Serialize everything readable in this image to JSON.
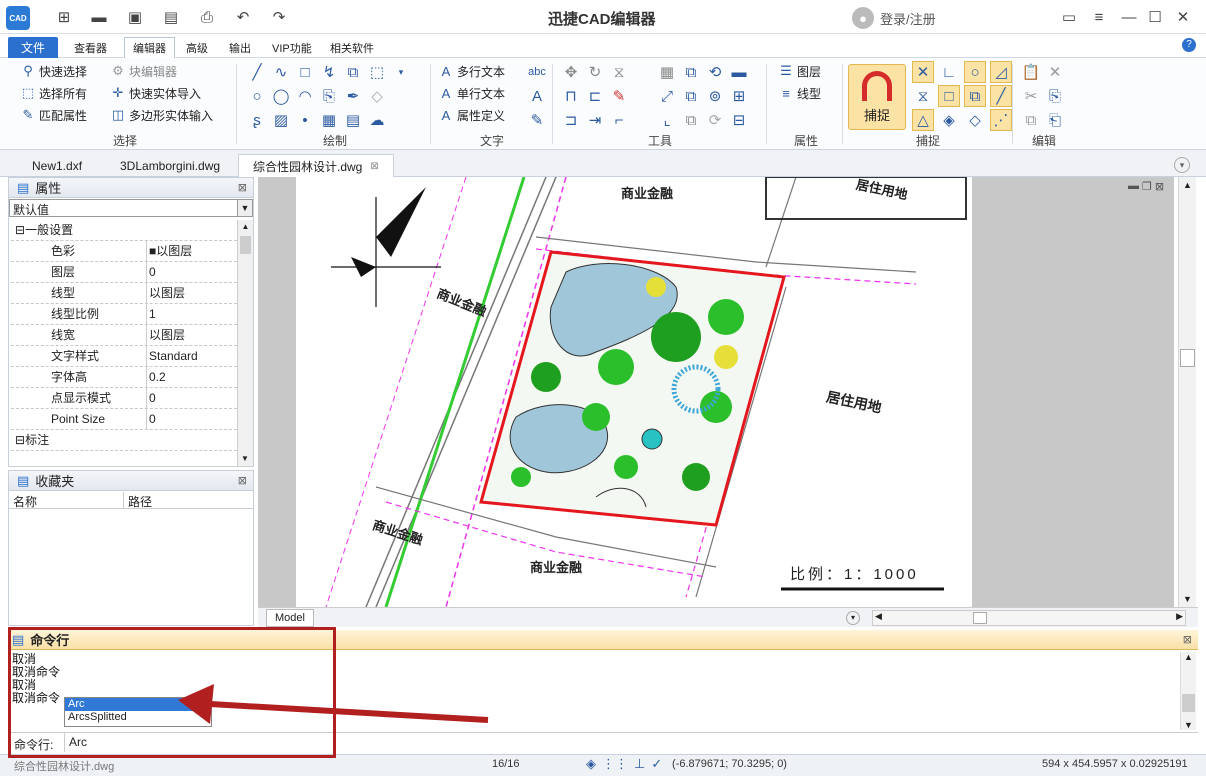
{
  "app": {
    "title": "迅捷CAD编辑器",
    "logo_text": "CAD",
    "login_text": "登录/注册"
  },
  "quick_toolbar": [
    "new-icon",
    "open-icon",
    "save-icon",
    "pdf-icon",
    "print-icon",
    "undo-icon",
    "redo-icon"
  ],
  "menu_tabs": [
    {
      "label": "文件"
    },
    {
      "label": "查看器"
    },
    {
      "label": "编辑器"
    },
    {
      "label": "高级"
    },
    {
      "label": "输出"
    },
    {
      "label": "VIP功能"
    },
    {
      "label": "相关软件"
    }
  ],
  "ribbon": {
    "select": {
      "label": "选择",
      "items": [
        "快速选择",
        "块编辑器",
        "选择所有",
        "快速实体导入",
        "匹配属性",
        "多边形实体输入"
      ]
    },
    "draw": {
      "label": "绘制"
    },
    "text": {
      "label": "文字",
      "items": [
        "多行文本",
        "单行文本",
        "属性定义"
      ]
    },
    "tools": {
      "label": "工具"
    },
    "properties": {
      "label": "属性",
      "items": [
        "图层",
        "线型"
      ]
    },
    "snap": {
      "label": "捕捉",
      "big_button": "捕捉"
    },
    "edit": {
      "label": "编辑"
    }
  },
  "doc_tabs": [
    {
      "label": "New1.dxf"
    },
    {
      "label": "3DLamborgini.dwg"
    },
    {
      "label": "综合性园林设计.dwg"
    }
  ],
  "properties_panel": {
    "title": "属性",
    "dropdown_value": "默认值",
    "category_general": "一般设置",
    "rows": [
      {
        "key": "色彩",
        "value": "■以图层"
      },
      {
        "key": "图层",
        "value": "0"
      },
      {
        "key": "线型",
        "value": "以图层"
      },
      {
        "key": "线型比例",
        "value": "1"
      },
      {
        "key": "线宽",
        "value": "以图层"
      },
      {
        "key": "文字样式",
        "value": "Standard"
      },
      {
        "key": "字体高",
        "value": "0.2"
      },
      {
        "key": "点显示模式",
        "value": "0"
      },
      {
        "key": "Point Size",
        "value": "0"
      }
    ],
    "category_annotation": "标注"
  },
  "favorites_panel": {
    "title": "收藏夹",
    "columns": [
      "名称",
      "路径"
    ]
  },
  "drawing": {
    "labels": {
      "commerce_top": "商业金融",
      "commerce_left": "商业金融",
      "commerce_bottom_left": "商业金融",
      "commerce_bottom": "商业金融",
      "residential_right": "居住用地",
      "residential_top": "居住用地",
      "scale": "比例：1：1000"
    },
    "model_tab": "Model"
  },
  "command_panel": {
    "title": "命令行",
    "history": [
      "取消",
      "取消命令",
      "取消",
      "取消命令"
    ],
    "autocomplete": [
      "Arc",
      "ArcsSplitted"
    ],
    "prompt_label": "命令行:",
    "input_value": "Arc"
  },
  "status_bar": {
    "file": "综合性园林设计.dwg",
    "page": "16/16",
    "coords": "(-6.879671; 70.3295; 0)",
    "dims": "594 x 454.5957 x 0.02925191"
  },
  "colors": {
    "file_tab": "#2b6fcf",
    "annotation_red": "#b21f1f",
    "snap_button": "#fbe3a5"
  }
}
